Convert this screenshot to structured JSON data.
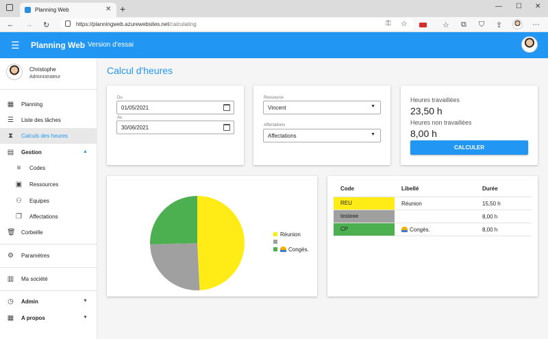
{
  "browser": {
    "tab_title": "Planning Web",
    "url_host": "https://planningweb.azurewebsites.net",
    "url_path": "/calculating"
  },
  "app": {
    "title": "Planning Web",
    "subtitle": "Version d'essai"
  },
  "user": {
    "name": "Christophe",
    "role": "Administrateur"
  },
  "nav": {
    "planning": "Planning",
    "tasks": "Liste des tâches",
    "calc": "Calculs des heures",
    "gestion": "Gestion",
    "codes": "Codes",
    "resources": "Ressources",
    "teams": "Equipes",
    "assign": "Affectations",
    "trash": "Corbeille",
    "settings": "Paramètres",
    "company": "Ma société",
    "admin": "Admin",
    "about": "A propos"
  },
  "page": {
    "title": "Calcul d'heures"
  },
  "filters": {
    "from_label": "Du",
    "from": "01/05/2021",
    "to_label": "Au",
    "to": "30/06/2021",
    "resource_label": "Ressource",
    "resource": "Vincent",
    "assign_label": "Affectations",
    "assign": "Affectations"
  },
  "stats": {
    "worked_label": "Heures travaillées",
    "worked": "23,50 h",
    "unworked_label": "Heures non travaillées",
    "unworked": "8,00 h",
    "button": "CALCULER"
  },
  "chart_data": {
    "type": "pie",
    "series": [
      {
        "name": "Réunion",
        "value": 15.5,
        "color": "#ffeb16"
      },
      {
        "name": "",
        "value": 8.0,
        "color": "#a0a0a0"
      },
      {
        "name": "Congès.",
        "value": 8.0,
        "color": "#4caf50"
      }
    ]
  },
  "table": {
    "headers": [
      "Code",
      "Libellé",
      "Durée"
    ],
    "rows": [
      {
        "code": "REU",
        "label": "Réunion",
        "duration": "15,50 h",
        "color": "#ffeb16",
        "icon": ""
      },
      {
        "code": "testeee",
        "label": "",
        "duration": "8,00 h",
        "color": "#a0a0a0",
        "icon": ""
      },
      {
        "code": "CP",
        "label": "Congès.",
        "duration": "8,00 h",
        "color": "#4caf50",
        "icon": "beach-umbrella-icon"
      }
    ]
  }
}
